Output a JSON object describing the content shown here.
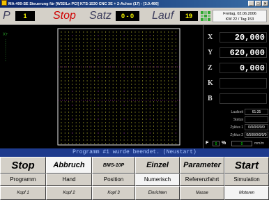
{
  "window": {
    "title": "MA-400-SE Steuerung für [W32/Lx PCI] KTS-1530 CNC 3E + 2-Achse (17) - [3.0.466]",
    "buttons": [
      "_",
      "□",
      "×"
    ]
  },
  "status": {
    "p_label": "P",
    "p_value": "1",
    "state_label": "Stop",
    "satz_label": "Satz",
    "satz_value": "0 - 0",
    "lauf_label": "Lauf",
    "lauf_value": "19",
    "date_line1": "Freitag, 02.06.2006",
    "date_line2": "KW 22 / Tag 153",
    "led_color": "#2fa82f"
  },
  "plot": {
    "axis_label": "X+",
    "background": "#000000",
    "grid_color": "#ffff40"
  },
  "axes": [
    {
      "label": "X",
      "value": "20,000"
    },
    {
      "label": "Y",
      "value": "620,000"
    },
    {
      "label": "Z",
      "value": "0,000"
    },
    {
      "label": "K",
      "value": ""
    },
    {
      "label": "B",
      "value": ""
    }
  ],
  "info": {
    "laufzeit_label": "Laufzeit",
    "laufzeit_value": "61:35",
    "status_label": "Status",
    "status_value": "",
    "zyklus1_label": "Zyklus 1",
    "zyklus1_value": "0/0/0/0/0/0",
    "zyklus2_label": "Zyklus 2",
    "zyklus2_value": "0/500/0/0/0/0"
  },
  "feed": {
    "f_label": "F",
    "f_value": "0",
    "pct_label": "%",
    "rate_value": "0",
    "unit": "mm/m"
  },
  "message": "Programm #1 wurde beendet. (Neustart)",
  "buttons_row1": [
    {
      "label": "Stop",
      "size": "big"
    },
    {
      "label": "Abbruch",
      "size": "mid"
    },
    {
      "label": "BMS-10P",
      "size": "small"
    },
    {
      "label": "Einzel",
      "size": "mid"
    },
    {
      "label": "Parameter",
      "size": "mid"
    },
    {
      "label": "Start",
      "size": "big"
    }
  ],
  "buttons_row2": [
    {
      "label": "Programm"
    },
    {
      "label": "Hand"
    },
    {
      "label": "Position"
    },
    {
      "label": "Numerisch",
      "active": true
    },
    {
      "label": "Referenzfahrt"
    },
    {
      "label": "Simulation"
    }
  ],
  "buttons_row3": [
    {
      "label": "Kopf 1"
    },
    {
      "label": "Kopf 2"
    },
    {
      "label": "Kopf 3"
    },
    {
      "label": "Einrichten"
    },
    {
      "label": "Masse"
    },
    {
      "label": "Motoren",
      "active": true
    }
  ]
}
